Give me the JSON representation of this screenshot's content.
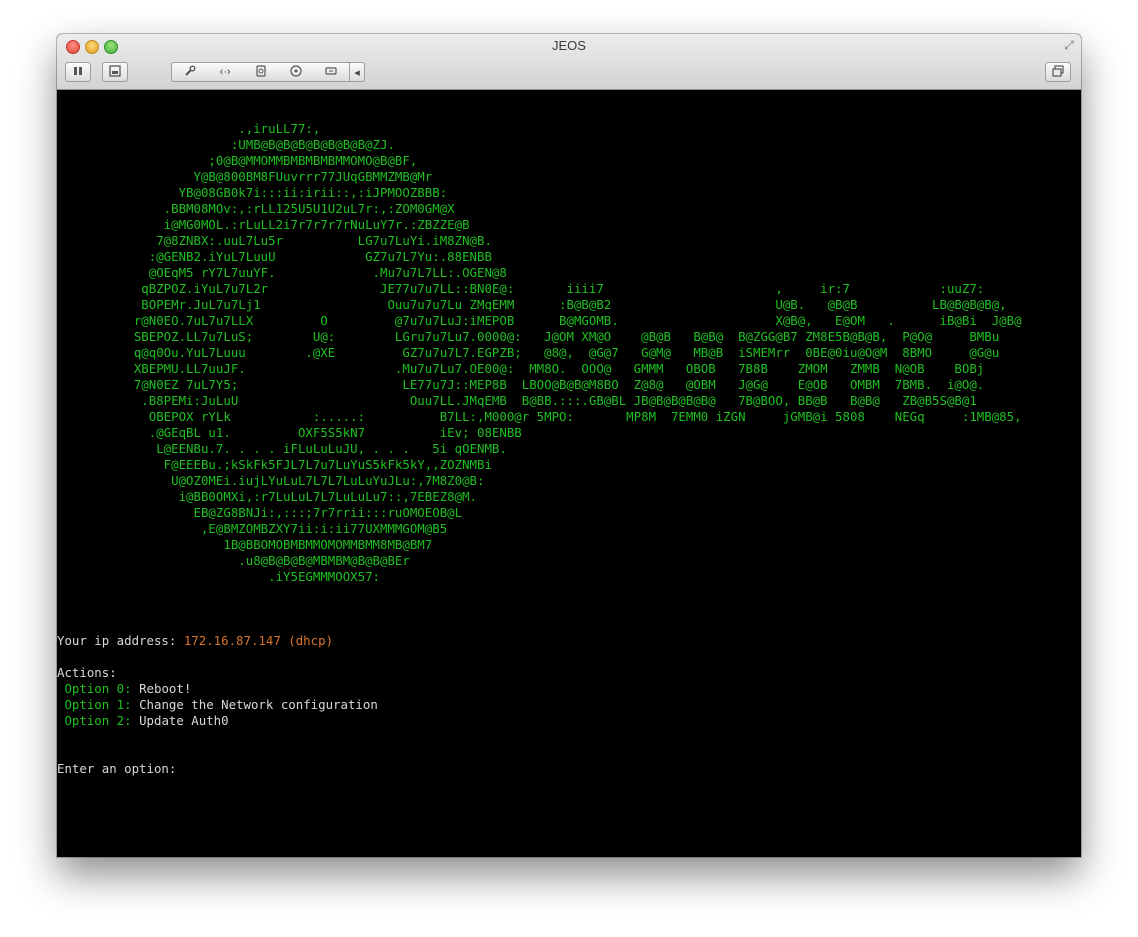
{
  "window": {
    "title": "JEOS",
    "toolbar": {
      "pause_icon": "pause-icon",
      "snapshot_icon": "snapshot-icon",
      "settings_icon": "wrench-icon",
      "network_icon": "network-arrows-icon",
      "disk_icon": "hard-disk-icon",
      "cd_icon": "cd-drive-icon",
      "usb_icon": "usb-icon",
      "more_icon": "chevron-left-icon",
      "view_icon": "window-restore-icon"
    }
  },
  "console": {
    "art_lines": [
      "                  .,iruLL77:,",
      "                 :UMB@B@B@B@B@B@B@B@ZJ.",
      "              ;0@B@MMOMMBMBMBMBMMOMO@B@BF,",
      "            Y@B@800BM8FUuvrrr77JUqGBMMZMB@Mr",
      "          YB@08GB0k7i:::ii:irii::,:iJPMOOZBBB:",
      "        .BBM08MOv:,:rLL125U5U1U2uL7r:,:ZOM0GM@X",
      "        i@MG0MOL.:rLuLL2i7r7r7r7rNuLuY7r.:ZBZZE@B",
      "       7@8ZNBX:.uuL7Lu5r          LG7u7LuYi.iM8ZN@B.",
      "      :@GENB2.iYuL7LuuU            GZ7u7L7Yu:.88ENBB",
      "      @OEqM5 rY7L7uuYF.             .Mu7u7L7LL:.OGEN@8",
      "     qBZPOZ.iYuL7u7L2r               JE77u7u7LL::BN0E@:       iiii7                       ,     ir:7            :uuZ7:",
      "     BOPEMr.JuL7u7Lj1                 Ouu7u7u7Lu ZMqEMM      :B@B@B2                      U@B.   @B@B          LB@B@B@B@,",
      "    r@N0EO.7uL7u7LLX         O         @7u7u7LuJ:iMEPOB      B@MGOMB.                     X@B@,   E@OM   .      iB@Bi  J@B@",
      "    SBEPOZ.LL7u7LuS;        U@:        LGru7u7Lu7.0000@:   J@OM XM@O    @B@B   B@B@  B@ZGG@B7 ZM8E5B@B@B,  P@O@     BMBu",
      "    q@q0Ou.YuL7Luuu        .@XE         GZ7u7u7L7.EGPZB;   @8@,  @G@7   G@M@   MB@B  iSMEMrr  0BE@0iu@O@M  8BMO     @G@u",
      "    XBEPMU.LL7uuJF.                    .Mu7u7Lu7.OE00@:  MM8O.  OOO@   GMMM   OBOB   7B8B    ZMOM   ZMMB  N@OB    BOBj",
      "    7@N0EZ 7uL7Y5;                      LE77u7J::MEP8B  LBOO@B@B@M8BO  Z@8@   @OBM   J@G@    E@OB   OMBM  7BMB.  i@O@.",
      "     .B8PEMi:JuLuU                       Ouu7LL.JMqEMB  B@BB.:::.GB@BL JB@B@B@B@B@   7B@BOO, BB@B   B@B@   ZB@B5S@B@1",
      "      OBEPOX rYLk           :.....:          B7LL:,M000@r 5MPO:       MP8M  7EMM0 iZGN     jGMB@i 5808    NEGq     :1MB@85,",
      "      .@GEqBL u1.         OXF5S5kN7          iEv; 08ENBB",
      "       L@EENBu.7. . . . iFLuLuLuJU, . . .   5i qOENMB.",
      "        F@EEEBu.;kSkFk5FJL7L7u7LuYuS5kFk5kY,,ZOZNMBi",
      "         U@OZ0MEi.iujLYuLuL7L7L7LuLuYuJLu:,7M8Z0@B:",
      "          i@BB0OMXi,:r7LuLuL7L7LuLuLu7::,7EBEZ8@M.",
      "            EB@ZG8BNJi:,:::;7r7rrii:::ruOMOEOB@L",
      "             ,E@BMZOMBZXY7ii:i:ii77UXMMMGOM@B5",
      "                1B@BBOMOBMBMMOMOMMBMM8MB@BM7",
      "                  .u8@B@B@B@MBMBM@B@B@BEr",
      "                      .iY5EGMMMOOX57:"
    ],
    "ip_label": "Your ip address:",
    "ip_value": "172.16.87.147 (dhcp)",
    "actions_label": "Actions:",
    "options": [
      {
        "key": "Option 0:",
        "label": "Reboot!"
      },
      {
        "key": "Option 1:",
        "label": "Change the Network configuration"
      },
      {
        "key": "Option 2:",
        "label": "Update Auth0"
      }
    ],
    "prompt": "Enter an option:"
  },
  "colors": {
    "console_bg": "#000000",
    "art_green": "#1fbf1f",
    "text_white": "#d8d8d8",
    "ip_orange": "#d9732a"
  }
}
